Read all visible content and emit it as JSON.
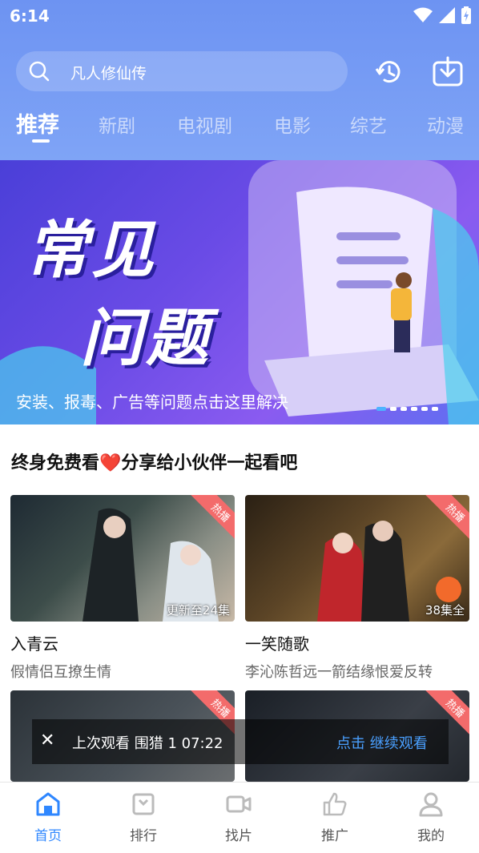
{
  "status": {
    "time": "6:14"
  },
  "search": {
    "text": "凡人修仙传"
  },
  "tabs": [
    "推荐",
    "新剧",
    "电视剧",
    "电影",
    "综艺",
    "动漫"
  ],
  "banner": {
    "title_line1": "常见",
    "title_line2": "问题",
    "caption": "安装、报毒、广告等问题点击这里解决"
  },
  "section": {
    "title": "终身免费看❤️分享给小伙伴一起看吧"
  },
  "cards": [
    {
      "badge": "热播",
      "episodes": "更新至24集",
      "name": "入青云",
      "desc": "假情侣互撩生情"
    },
    {
      "badge": "热播",
      "episodes": "38集全",
      "name": "一笑随歌",
      "desc": "李沁陈哲远一箭结缘恨爱反转"
    },
    {
      "badge": "热播"
    },
    {
      "badge": "热播"
    }
  ],
  "resume": {
    "close": "✕",
    "text": "上次观看 围猎 1   07:22",
    "action": "点击 继续观看"
  },
  "nav": {
    "home": "首页",
    "rank": "排行",
    "find": "找片",
    "promo": "推广",
    "mine": "我的"
  },
  "colors": {
    "accent": "#2f87ff",
    "badge": "#f36b6b",
    "banner": "#6a4be6"
  }
}
